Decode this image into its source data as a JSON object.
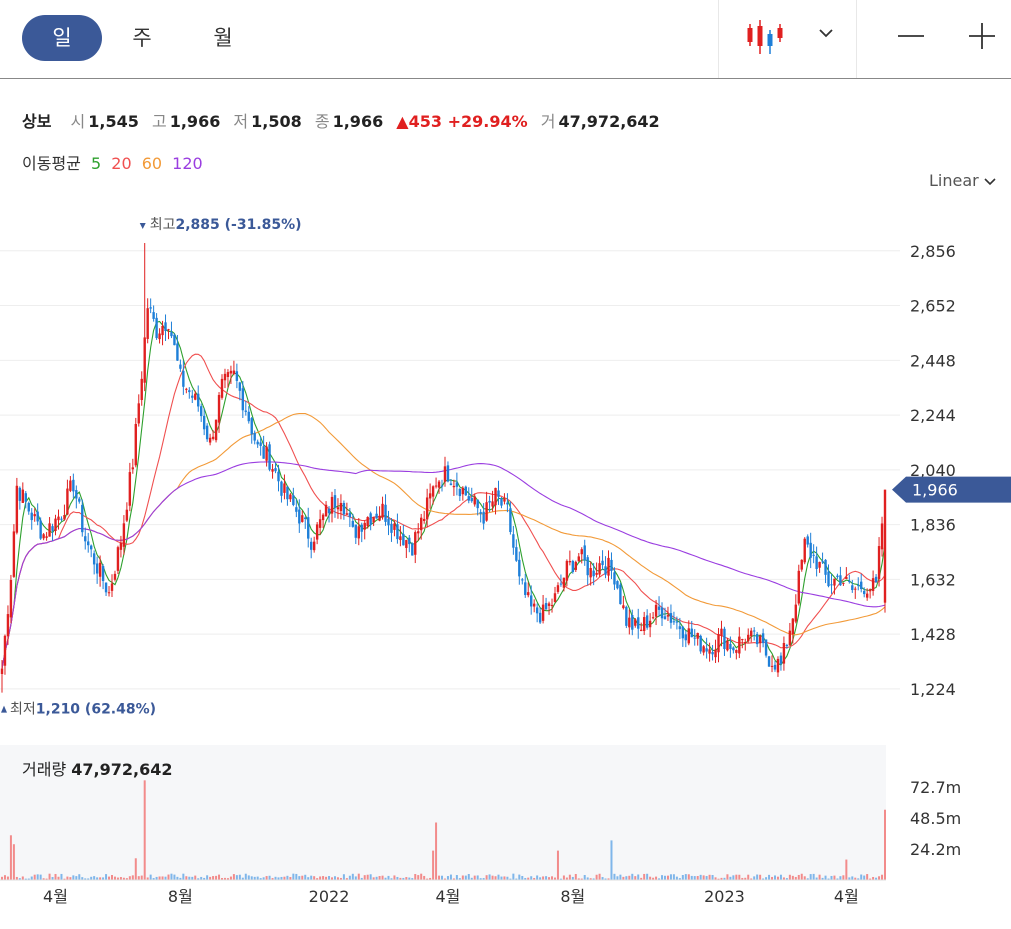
{
  "tabs": [
    "일",
    "주",
    "월"
  ],
  "icons": {
    "chart_type": "candlestick-icon",
    "dropdown": "chevron-down-icon",
    "zoom_out": "minus-icon",
    "zoom_in": "plus-icon"
  },
  "info": {
    "name": "상보",
    "open_label": "시",
    "open": "1,545",
    "high_label": "고",
    "high": "1,966",
    "low_label": "저",
    "low": "1,508",
    "close_label": "종",
    "close": "1,966",
    "change": "▲453 +29.94%",
    "vol_label": "거",
    "volume": "47,972,642"
  },
  "ma": {
    "label": "이동평균",
    "p5": "5",
    "p20": "20",
    "p60": "60",
    "p120": "120"
  },
  "scale_mode": "Linear",
  "colors": {
    "up": "#e02020",
    "down": "#1e7fd8",
    "ma5": "#2ea02e",
    "ma20": "#f05050",
    "ma60": "#f29a38",
    "ma120": "#9a3de0",
    "accent": "#3b5998"
  },
  "chart_data": {
    "type": "candlestick",
    "y_ticks": [
      "2,856",
      "2,652",
      "2,448",
      "2,244",
      "2,040",
      "1,836",
      "1,632",
      "1,428",
      "1,224"
    ],
    "y_tick_values": [
      2856,
      2652,
      2448,
      2244,
      2040,
      1836,
      1632,
      1428,
      1224
    ],
    "ylim": [
      1160,
      2900
    ],
    "x_ticks": [
      "4월",
      "8월",
      "2022",
      "4월",
      "8월",
      "2023",
      "4월"
    ],
    "x_tick_index": [
      18,
      60,
      110,
      150,
      192,
      243,
      284
    ],
    "current_price": "1,966",
    "current_value": 1966,
    "max_label": "최고",
    "max_text": "2,885 (-31.85%)",
    "max_value": 2885,
    "max_index": 48,
    "min_label": "최저",
    "min_text": "1,210 (62.48%)",
    "min_value": 1210,
    "min_index": 0,
    "anchors": [
      [
        0,
        1300
      ],
      [
        3,
        1650
      ],
      [
        5,
        1980
      ],
      [
        10,
        1870
      ],
      [
        14,
        1800
      ],
      [
        20,
        1880
      ],
      [
        24,
        1990
      ],
      [
        28,
        1780
      ],
      [
        32,
        1680
      ],
      [
        36,
        1580
      ],
      [
        40,
        1780
      ],
      [
        44,
        2070
      ],
      [
        47,
        2400
      ],
      [
        49,
        2650
      ],
      [
        52,
        2560
      ],
      [
        56,
        2600
      ],
      [
        60,
        2380
      ],
      [
        66,
        2280
      ],
      [
        70,
        2140
      ],
      [
        74,
        2350
      ],
      [
        78,
        2390
      ],
      [
        82,
        2270
      ],
      [
        86,
        2120
      ],
      [
        90,
        2080
      ],
      [
        95,
        1950
      ],
      [
        100,
        1870
      ],
      [
        104,
        1780
      ],
      [
        110,
        1900
      ],
      [
        114,
        1950
      ],
      [
        118,
        1800
      ],
      [
        122,
        1860
      ],
      [
        128,
        1890
      ],
      [
        134,
        1800
      ],
      [
        138,
        1760
      ],
      [
        142,
        1870
      ],
      [
        146,
        2000
      ],
      [
        150,
        2030
      ],
      [
        154,
        1980
      ],
      [
        158,
        1920
      ],
      [
        162,
        1870
      ],
      [
        166,
        1940
      ],
      [
        170,
        1880
      ],
      [
        174,
        1620
      ],
      [
        178,
        1520
      ],
      [
        182,
        1500
      ],
      [
        186,
        1560
      ],
      [
        190,
        1670
      ],
      [
        194,
        1720
      ],
      [
        198,
        1660
      ],
      [
        202,
        1700
      ],
      [
        206,
        1650
      ],
      [
        210,
        1480
      ],
      [
        214,
        1440
      ],
      [
        218,
        1490
      ],
      [
        222,
        1520
      ],
      [
        226,
        1480
      ],
      [
        230,
        1440
      ],
      [
        234,
        1400
      ],
      [
        238,
        1380
      ],
      [
        242,
        1420
      ],
      [
        246,
        1380
      ],
      [
        250,
        1420
      ],
      [
        254,
        1400
      ],
      [
        258,
        1340
      ],
      [
        262,
        1310
      ],
      [
        266,
        1500
      ],
      [
        270,
        1760
      ],
      [
        274,
        1700
      ],
      [
        278,
        1620
      ],
      [
        282,
        1640
      ],
      [
        286,
        1590
      ],
      [
        290,
        1610
      ],
      [
        294,
        1600
      ],
      [
        297,
        1966
      ]
    ],
    "volume": {
      "label": "거래량",
      "value": "47,972,642",
      "ticks": [
        "72.7m",
        "48.5m",
        "24.2m"
      ],
      "tick_values": [
        72.7,
        48.5,
        24.2
      ],
      "ymax": 90
    },
    "volume_spikes": [
      [
        3,
        35
      ],
      [
        4,
        28
      ],
      [
        45,
        17
      ],
      [
        48,
        78
      ],
      [
        145,
        23
      ],
      [
        146,
        45
      ],
      [
        187,
        23
      ],
      [
        205,
        31
      ],
      [
        284,
        16
      ],
      [
        297,
        55
      ]
    ]
  }
}
